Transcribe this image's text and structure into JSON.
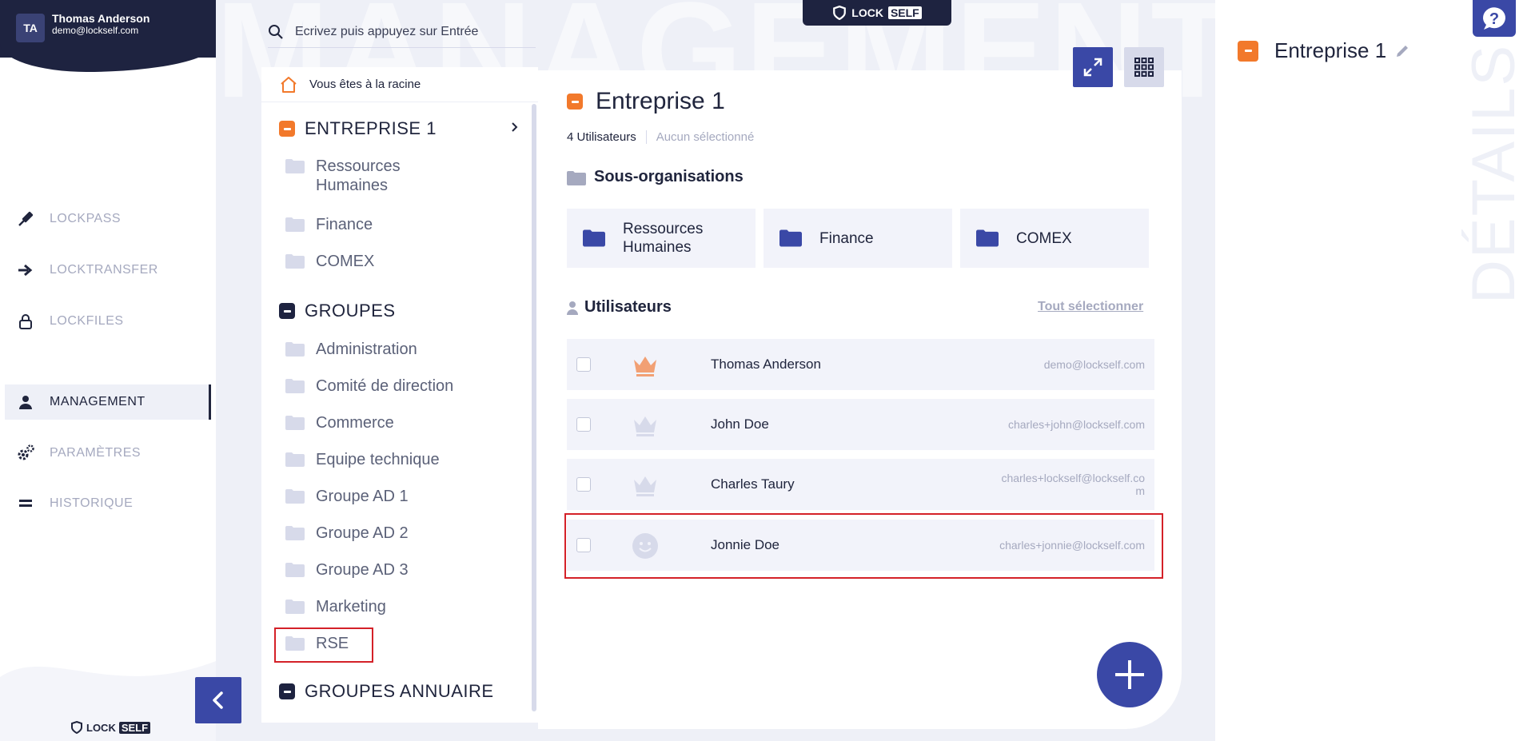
{
  "user": {
    "initials": "TA",
    "name": "Thomas Anderson",
    "email": "demo@lockself.com"
  },
  "sidebar": {
    "items": [
      {
        "label": "LOCKPASS",
        "icon": "pen-icon"
      },
      {
        "label": "LOCKTRANSFER",
        "icon": "arrow-right-icon"
      },
      {
        "label": "LOCKFILES",
        "icon": "lock-icon"
      },
      {
        "label": "MANAGEMENT",
        "icon": "user-icon",
        "active": true
      },
      {
        "label": "PARAMÈTRES",
        "icon": "gears-icon"
      },
      {
        "label": "HISTORIQUE",
        "icon": "equals-icon"
      }
    ],
    "logo_lock": "LOCK",
    "logo_self": "SELF"
  },
  "watermark": "MANAGEMENT",
  "search": {
    "placeholder": "Ecrivez puis appuyez sur Entrée"
  },
  "top_logo": {
    "lock": "LOCK",
    "self": "SELF"
  },
  "tree": {
    "breadcrumb": "Vous êtes à la racine",
    "company": "ENTREPRISE 1",
    "company_children": [
      "Ressources Humaines",
      "Finance",
      "COMEX"
    ],
    "groups_label": "GROUPES",
    "groups": [
      "Administration",
      "Comité de direction",
      "Commerce",
      "Equipe technique",
      "Groupe AD 1",
      "Groupe AD 2",
      "Groupe AD 3",
      "Marketing",
      "RSE"
    ],
    "directory_groups_label": "GROUPES ANNUAIRE"
  },
  "main": {
    "title": "Entreprise 1",
    "users_count": "4 Utilisateurs",
    "selected": "Aucun sélectionné",
    "suborgs_heading": "Sous-organisations",
    "suborgs": [
      "Ressources Humaines",
      "Finance",
      "COMEX"
    ],
    "users_heading": "Utilisateurs",
    "select_all": "Tout sélectionner",
    "users": [
      {
        "name": "Thomas Anderson",
        "email": "demo@lockself.com",
        "role": "crown-admin-icon",
        "role_color": "#f2a074"
      },
      {
        "name": "John Doe",
        "email": "charles+john@lockself.com",
        "role": "crown-icon",
        "role_color": "#d7daea"
      },
      {
        "name": "Charles Taury",
        "email": "charles+lockself@lockself.com",
        "role": "crown-icon",
        "role_color": "#d7daea"
      },
      {
        "name": "Jonnie Doe",
        "email": "charles+jonnie@lockself.com",
        "role": "smiley-icon",
        "role_color": "#d7daea"
      }
    ]
  },
  "details": {
    "title": "Entreprise 1",
    "vertical_label": "DÉTAILS"
  },
  "colors": {
    "navy": "#1e2340",
    "accent_blue": "#3a48a6",
    "orange": "#f2792b",
    "muted": "#a5a9bf",
    "highlight_red": "#d42128"
  }
}
